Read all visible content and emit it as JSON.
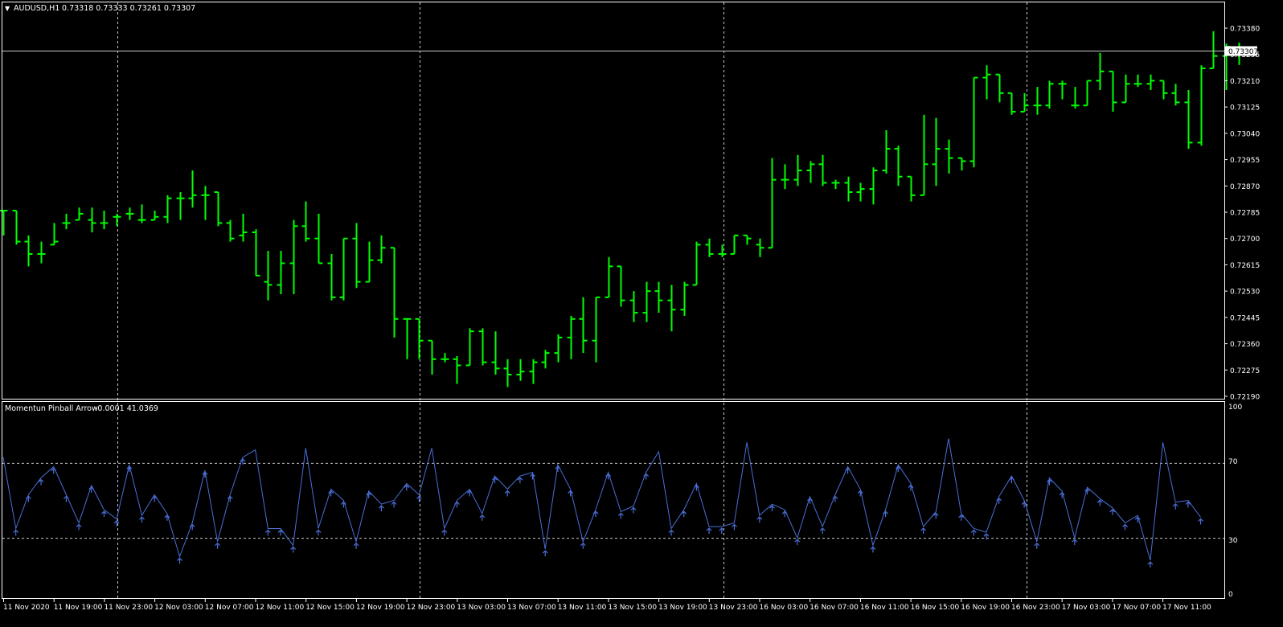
{
  "header": {
    "menu_glyph": "▼",
    "symbol": "AUDUSD,H1",
    "ohlc": "0.73318 0.73333 0.73261 0.73307"
  },
  "indicator": {
    "label": "Momentun Pinball Arrow",
    "values": "-0.0001 41.0369",
    "axis_top": "100",
    "axis_70": "70",
    "axis_30": "30",
    "axis_bottom": "0"
  },
  "price": {
    "current_label": "0.73307",
    "axis_labels": [
      "0.73380",
      "0.73295",
      "0.73210",
      "0.73125",
      "0.73040",
      "0.72955",
      "0.72870",
      "0.72785",
      "0.72700",
      "0.72615",
      "0.72530",
      "0.72445",
      "0.72360",
      "0.72275",
      "0.72190"
    ]
  },
  "time_labels": [
    "11 Nov 2020",
    "11 Nov 19:00",
    "11 Nov 23:00",
    "12 Nov 03:00",
    "12 Nov 07:00",
    "12 Nov 11:00",
    "12 Nov 15:00",
    "12 Nov 19:00",
    "12 Nov 23:00",
    "13 Nov 03:00",
    "13 Nov 07:00",
    "13 Nov 11:00",
    "13 Nov 15:00",
    "13 Nov 19:00",
    "13 Nov 23:00",
    "16 Nov 03:00",
    "16 Nov 07:00",
    "16 Nov 11:00",
    "16 Nov 15:00",
    "16 Nov 19:00",
    "16 Nov 23:00",
    "17 Nov 03:00",
    "17 Nov 07:00",
    "17 Nov 11:00"
  ],
  "colors": {
    "background": "#000000",
    "bars": "#00ff00",
    "indicator_line": "#4a6fd8",
    "grid": "#c8c8c8",
    "frame": "#ffffff"
  },
  "chart_data": [
    {
      "type": "ohlc",
      "symbol": "AUDUSD",
      "timeframe": "H1",
      "ylim": [
        0.7219,
        0.7338
      ],
      "bars": [
        {
          "o": 0.7279,
          "h": 0.7279,
          "l": 0.7271,
          "c": 0.7279
        },
        {
          "o": 0.7279,
          "h": 0.7279,
          "l": 0.7268,
          "c": 0.7269
        },
        {
          "o": 0.7269,
          "h": 0.7271,
          "l": 0.7261,
          "c": 0.7265
        },
        {
          "o": 0.7265,
          "h": 0.7269,
          "l": 0.7262,
          "c": 0.7265
        },
        {
          "o": 0.7268,
          "h": 0.7275,
          "l": 0.7268,
          "c": 0.7269
        },
        {
          "o": 0.7275,
          "h": 0.7278,
          "l": 0.7273,
          "c": 0.7275
        },
        {
          "o": 0.7276,
          "h": 0.728,
          "l": 0.7276,
          "c": 0.7278
        },
        {
          "o": 0.7276,
          "h": 0.728,
          "l": 0.7272,
          "c": 0.7275
        },
        {
          "o": 0.7275,
          "h": 0.7279,
          "l": 0.7273,
          "c": 0.7275
        },
        {
          "o": 0.7277,
          "h": 0.7278,
          "l": 0.7274,
          "c": 0.7277
        },
        {
          "o": 0.7278,
          "h": 0.728,
          "l": 0.7276,
          "c": 0.7278
        },
        {
          "o": 0.7276,
          "h": 0.7281,
          "l": 0.7275,
          "c": 0.7276
        },
        {
          "o": 0.7276,
          "h": 0.7279,
          "l": 0.7276,
          "c": 0.7277
        },
        {
          "o": 0.7277,
          "h": 0.7284,
          "l": 0.7275,
          "c": 0.7283
        },
        {
          "o": 0.7283,
          "h": 0.7285,
          "l": 0.7276,
          "c": 0.7283
        },
        {
          "o": 0.7283,
          "h": 0.7292,
          "l": 0.728,
          "c": 0.7284
        },
        {
          "o": 0.7284,
          "h": 0.7287,
          "l": 0.7276,
          "c": 0.7284
        },
        {
          "o": 0.7285,
          "h": 0.7285,
          "l": 0.7274,
          "c": 0.7275
        },
        {
          "o": 0.7275,
          "h": 0.7276,
          "l": 0.7269,
          "c": 0.727
        },
        {
          "o": 0.7271,
          "h": 0.7278,
          "l": 0.7269,
          "c": 0.7272
        },
        {
          "o": 0.7272,
          "h": 0.7273,
          "l": 0.7258,
          "c": 0.7258
        },
        {
          "o": 0.7256,
          "h": 0.7266,
          "l": 0.725,
          "c": 0.7255
        },
        {
          "o": 0.7255,
          "h": 0.7266,
          "l": 0.7252,
          "c": 0.7262
        },
        {
          "o": 0.7262,
          "h": 0.7276,
          "l": 0.7252,
          "c": 0.7274
        },
        {
          "o": 0.7274,
          "h": 0.7282,
          "l": 0.7269,
          "c": 0.727
        },
        {
          "o": 0.727,
          "h": 0.7278,
          "l": 0.7262,
          "c": 0.7262
        },
        {
          "o": 0.7262,
          "h": 0.7265,
          "l": 0.725,
          "c": 0.7251
        },
        {
          "o": 0.7251,
          "h": 0.727,
          "l": 0.725,
          "c": 0.727
        },
        {
          "o": 0.727,
          "h": 0.7275,
          "l": 0.7254,
          "c": 0.7256
        },
        {
          "o": 0.7256,
          "h": 0.7269,
          "l": 0.7256,
          "c": 0.7263
        },
        {
          "o": 0.7263,
          "h": 0.7271,
          "l": 0.7262,
          "c": 0.7267
        },
        {
          "o": 0.7267,
          "h": 0.7267,
          "l": 0.7238,
          "c": 0.7244
        },
        {
          "o": 0.7244,
          "h": 0.7244,
          "l": 0.7231,
          "c": 0.7244
        },
        {
          "o": 0.7244,
          "h": 0.7244,
          "l": 0.7231,
          "c": 0.7237
        },
        {
          "o": 0.7237,
          "h": 0.7237,
          "l": 0.7226,
          "c": 0.7231
        },
        {
          "o": 0.7231,
          "h": 0.7233,
          "l": 0.723,
          "c": 0.7231
        },
        {
          "o": 0.7231,
          "h": 0.7232,
          "l": 0.7223,
          "c": 0.7229
        },
        {
          "o": 0.7229,
          "h": 0.7241,
          "l": 0.7229,
          "c": 0.724
        },
        {
          "o": 0.724,
          "h": 0.7241,
          "l": 0.7229,
          "c": 0.723
        },
        {
          "o": 0.723,
          "h": 0.724,
          "l": 0.7226,
          "c": 0.7228
        },
        {
          "o": 0.7228,
          "h": 0.7231,
          "l": 0.7222,
          "c": 0.7226
        },
        {
          "o": 0.7226,
          "h": 0.7231,
          "l": 0.7224,
          "c": 0.7227
        },
        {
          "o": 0.7227,
          "h": 0.7231,
          "l": 0.7223,
          "c": 0.723
        },
        {
          "o": 0.723,
          "h": 0.7234,
          "l": 0.7228,
          "c": 0.7233
        },
        {
          "o": 0.7233,
          "h": 0.7239,
          "l": 0.723,
          "c": 0.7238
        },
        {
          "o": 0.7238,
          "h": 0.7245,
          "l": 0.7231,
          "c": 0.7244
        },
        {
          "o": 0.7244,
          "h": 0.7251,
          "l": 0.7233,
          "c": 0.7237
        },
        {
          "o": 0.7237,
          "h": 0.7251,
          "l": 0.723,
          "c": 0.7251
        },
        {
          "o": 0.7251,
          "h": 0.7264,
          "l": 0.7251,
          "c": 0.7261
        },
        {
          "o": 0.7261,
          "h": 0.7261,
          "l": 0.7248,
          "c": 0.725
        },
        {
          "o": 0.725,
          "h": 0.7253,
          "l": 0.7243,
          "c": 0.7246
        },
        {
          "o": 0.7246,
          "h": 0.7256,
          "l": 0.7243,
          "c": 0.7253
        },
        {
          "o": 0.7253,
          "h": 0.7256,
          "l": 0.7246,
          "c": 0.725
        },
        {
          "o": 0.725,
          "h": 0.7255,
          "l": 0.724,
          "c": 0.7247
        },
        {
          "o": 0.7247,
          "h": 0.7256,
          "l": 0.7245,
          "c": 0.7255
        },
        {
          "o": 0.7255,
          "h": 0.7269,
          "l": 0.7255,
          "c": 0.7268
        },
        {
          "o": 0.7268,
          "h": 0.727,
          "l": 0.7264,
          "c": 0.7265
        },
        {
          "o": 0.7265,
          "h": 0.7268,
          "l": 0.7264,
          "c": 0.7265
        },
        {
          "o": 0.7265,
          "h": 0.7271,
          "l": 0.7265,
          "c": 0.7271
        },
        {
          "o": 0.7271,
          "h": 0.7271,
          "l": 0.7268,
          "c": 0.727
        },
        {
          "o": 0.7268,
          "h": 0.727,
          "l": 0.7264,
          "c": 0.7267
        },
        {
          "o": 0.7267,
          "h": 0.7296,
          "l": 0.7267,
          "c": 0.7289
        },
        {
          "o": 0.7289,
          "h": 0.7294,
          "l": 0.7286,
          "c": 0.7289
        },
        {
          "o": 0.7289,
          "h": 0.7297,
          "l": 0.7287,
          "c": 0.7292
        },
        {
          "o": 0.7292,
          "h": 0.7295,
          "l": 0.7288,
          "c": 0.7294
        },
        {
          "o": 0.7294,
          "h": 0.7297,
          "l": 0.7287,
          "c": 0.7288
        },
        {
          "o": 0.7288,
          "h": 0.7289,
          "l": 0.7286,
          "c": 0.7288
        },
        {
          "o": 0.7288,
          "h": 0.729,
          "l": 0.7282,
          "c": 0.7285
        },
        {
          "o": 0.7285,
          "h": 0.7288,
          "l": 0.7282,
          "c": 0.7286
        },
        {
          "o": 0.7286,
          "h": 0.7293,
          "l": 0.7281,
          "c": 0.7292
        },
        {
          "o": 0.7292,
          "h": 0.7305,
          "l": 0.7291,
          "c": 0.7299
        },
        {
          "o": 0.7299,
          "h": 0.73,
          "l": 0.7287,
          "c": 0.729
        },
        {
          "o": 0.729,
          "h": 0.729,
          "l": 0.7282,
          "c": 0.7284
        },
        {
          "o": 0.7284,
          "h": 0.731,
          "l": 0.7284,
          "c": 0.7294
        },
        {
          "o": 0.7294,
          "h": 0.7309,
          "l": 0.7287,
          "c": 0.7299
        },
        {
          "o": 0.7299,
          "h": 0.7302,
          "l": 0.7291,
          "c": 0.7296
        },
        {
          "o": 0.7296,
          "h": 0.7296,
          "l": 0.7292,
          "c": 0.7295
        },
        {
          "o": 0.7295,
          "h": 0.7322,
          "l": 0.7293,
          "c": 0.7322
        },
        {
          "o": 0.7322,
          "h": 0.7326,
          "l": 0.7315,
          "c": 0.7323
        },
        {
          "o": 0.7323,
          "h": 0.7323,
          "l": 0.7314,
          "c": 0.7317
        },
        {
          "o": 0.7317,
          "h": 0.7317,
          "l": 0.731,
          "c": 0.7311
        },
        {
          "o": 0.7311,
          "h": 0.7317,
          "l": 0.7311,
          "c": 0.7313
        },
        {
          "o": 0.7313,
          "h": 0.7319,
          "l": 0.731,
          "c": 0.7313
        },
        {
          "o": 0.7313,
          "h": 0.7321,
          "l": 0.7312,
          "c": 0.732
        },
        {
          "o": 0.732,
          "h": 0.7321,
          "l": 0.7315,
          "c": 0.732
        },
        {
          "o": 0.7313,
          "h": 0.7319,
          "l": 0.7312,
          "c": 0.7313
        },
        {
          "o": 0.7313,
          "h": 0.7321,
          "l": 0.7313,
          "c": 0.7321
        },
        {
          "o": 0.7321,
          "h": 0.733,
          "l": 0.7318,
          "c": 0.7324
        },
        {
          "o": 0.7324,
          "h": 0.7324,
          "l": 0.7311,
          "c": 0.7314
        },
        {
          "o": 0.7314,
          "h": 0.7323,
          "l": 0.7314,
          "c": 0.732
        },
        {
          "o": 0.732,
          "h": 0.7323,
          "l": 0.7319,
          "c": 0.732
        },
        {
          "o": 0.732,
          "h": 0.7323,
          "l": 0.7318,
          "c": 0.7321
        },
        {
          "o": 0.7321,
          "h": 0.7321,
          "l": 0.7315,
          "c": 0.7317
        },
        {
          "o": 0.7317,
          "h": 0.732,
          "l": 0.7313,
          "c": 0.7314
        },
        {
          "o": 0.7314,
          "h": 0.7318,
          "l": 0.7299,
          "c": 0.7301
        },
        {
          "o": 0.7301,
          "h": 0.7326,
          "l": 0.73,
          "c": 0.7325
        },
        {
          "o": 0.7325,
          "h": 0.7337,
          "l": 0.7325,
          "c": 0.7329
        },
        {
          "o": 0.7329,
          "h": 0.7333,
          "l": 0.7318,
          "c": 0.7332
        },
        {
          "o": 0.73318,
          "h": 0.73333,
          "l": 0.73261,
          "c": 0.73307
        }
      ]
    },
    {
      "type": "line",
      "name": "Momentun Pinball Arrow",
      "ylim": [
        0,
        100
      ],
      "levels": [
        30,
        70
      ],
      "values": [
        73,
        35,
        53,
        62,
        68,
        53,
        38,
        58,
        45,
        40,
        69,
        42,
        53,
        43,
        20,
        38,
        66,
        28,
        53,
        73,
        77,
        35,
        35,
        26,
        78,
        35,
        56,
        50,
        28,
        55,
        48,
        50,
        59,
        53,
        78,
        35,
        50,
        56,
        43,
        63,
        56,
        63,
        65,
        24,
        69,
        56,
        28,
        45,
        65,
        44,
        47,
        65,
        76,
        35,
        45,
        59,
        36,
        36,
        38,
        81,
        42,
        48,
        45,
        30,
        52,
        36,
        53,
        68,
        56,
        26,
        45,
        69,
        59,
        36,
        44,
        83,
        43,
        35,
        33,
        52,
        63,
        50,
        28,
        62,
        55,
        30,
        57,
        51,
        46,
        38,
        42,
        18,
        81,
        49,
        50,
        41
      ]
    }
  ]
}
